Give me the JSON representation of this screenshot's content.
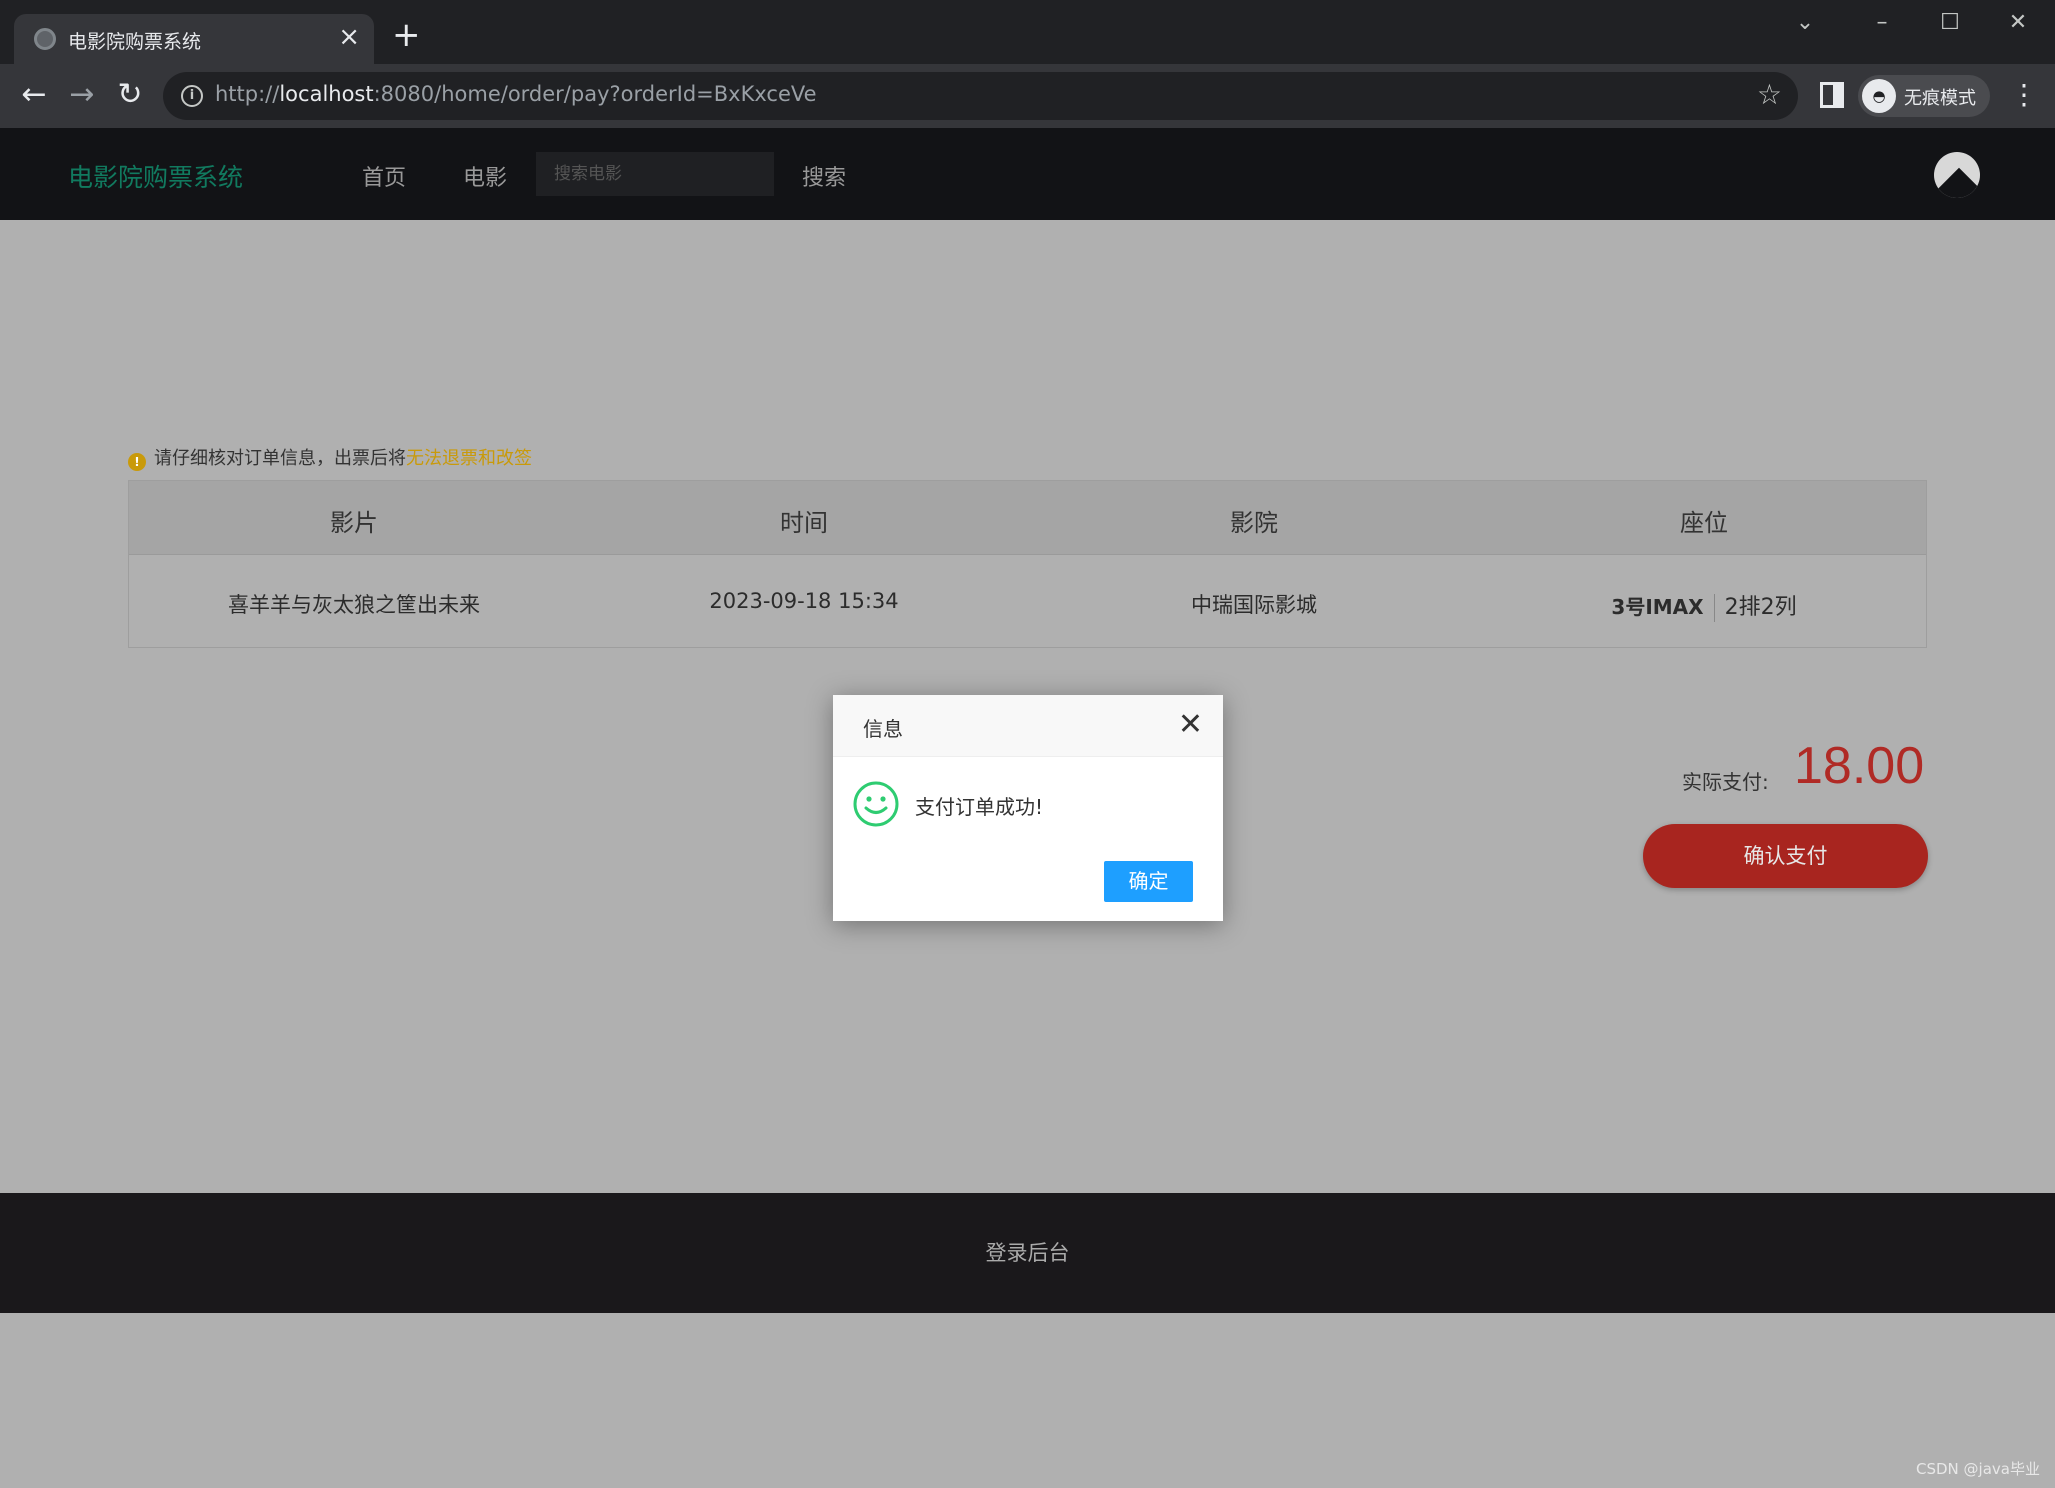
{
  "browser": {
    "tab_title": "电影院购票系统",
    "tab_close": "×",
    "new_tab": "+",
    "url_scheme": "http://",
    "url_host": "localhost",
    "url_rest": ":8080/home/order/pay?orderId=BxKxceVe",
    "incognito_label": "无痕模式"
  },
  "header": {
    "brand": "电影院购票系统",
    "nav": [
      "首页",
      "电影"
    ],
    "search_placeholder": "搜索电影",
    "search_button": "搜索"
  },
  "notice": {
    "text": "请仔细核对订单信息，出票后将",
    "warning": "无法退票和改签"
  },
  "order_table": {
    "headers": [
      "影片",
      "时间",
      "影院",
      "座位"
    ],
    "row": {
      "movie": "喜羊羊与灰太狼之筐出未来",
      "time": "2023-09-18 15:34",
      "cinema": "中瑞国际影城",
      "hall": "3号IMAX",
      "seat": "2排2列"
    }
  },
  "payment": {
    "label": "实际支付:",
    "amount": "18.00",
    "confirm_button": "确认支付"
  },
  "footer": {
    "link": "登录后台",
    "watermark": "CSDN @java毕业"
  },
  "dialog": {
    "title": "信息",
    "message": "支付订单成功!",
    "ok_button": "确定"
  },
  "colors": {
    "brand": "#117a5f",
    "price": "#b02a25",
    "confirm_button": "#a8251f",
    "dialog_button": "#1e9fff",
    "success_icon": "#2ecc71",
    "warning": "#c99a0a"
  }
}
